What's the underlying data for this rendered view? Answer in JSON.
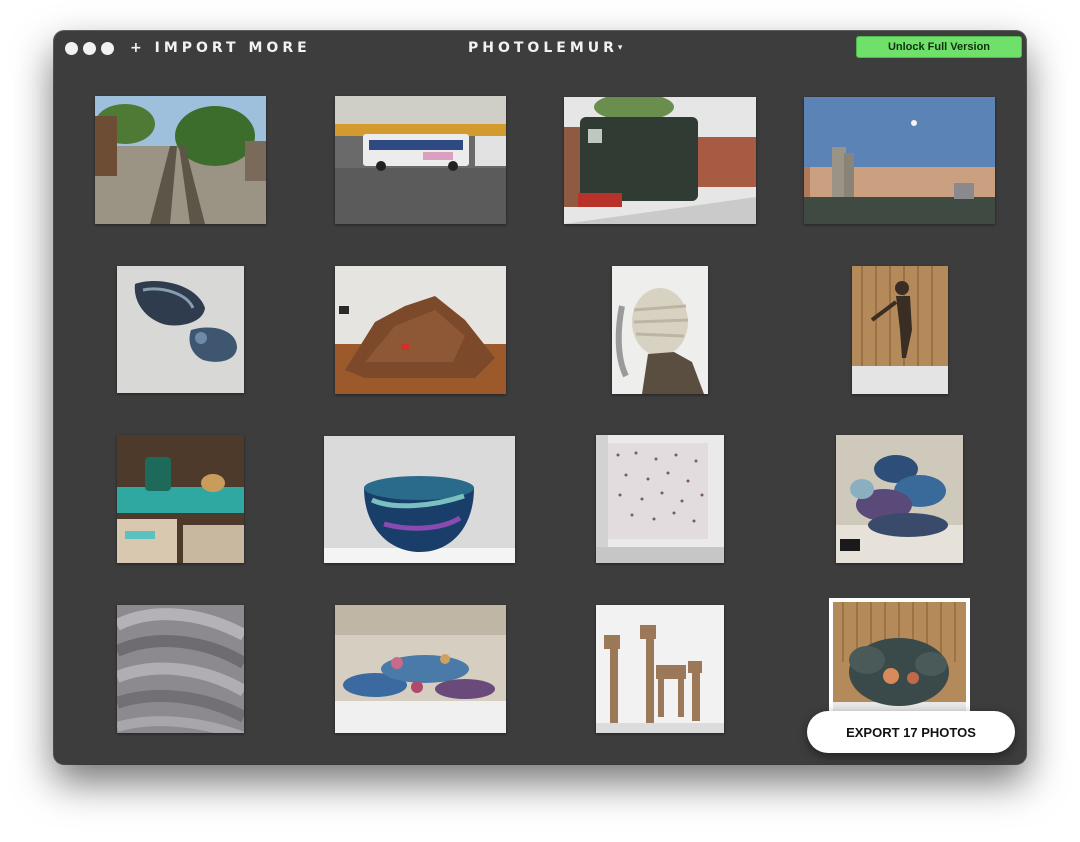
{
  "header": {
    "import_label": "+ IMPORT MORE",
    "app_title": "PHOTOLEMUR",
    "title_caret": "▾",
    "unlock_label": "Unlock Full Version"
  },
  "footer": {
    "export_label": "EXPORT 17 PHOTOS"
  },
  "photos": [
    {
      "name": "railway-track-photo"
    },
    {
      "name": "bus-station-photo"
    },
    {
      "name": "green-locomotive-photo"
    },
    {
      "name": "city-skyline-dusk-photo"
    },
    {
      "name": "ceramic-fish-sculpture-photo"
    },
    {
      "name": "brick-installation-photo"
    },
    {
      "name": "bandaged-head-sculpture-photo"
    },
    {
      "name": "bronze-figure-sculpture-photo"
    },
    {
      "name": "teal-glass-jar-photo"
    },
    {
      "name": "iridescent-bowl-photo"
    },
    {
      "name": "dotted-wall-installation-photo"
    },
    {
      "name": "blue-abstract-sculpture-photo"
    },
    {
      "name": "metal-feathers-photo"
    },
    {
      "name": "coral-ceramic-table-photo"
    },
    {
      "name": "wooden-deer-photo"
    },
    {
      "name": "dragon-head-sculpture-photo",
      "selected": true
    }
  ],
  "colors": {
    "window_bg": "#3d3d3d",
    "unlock_bg": "#6fe06a",
    "selection": "#ffffff"
  }
}
